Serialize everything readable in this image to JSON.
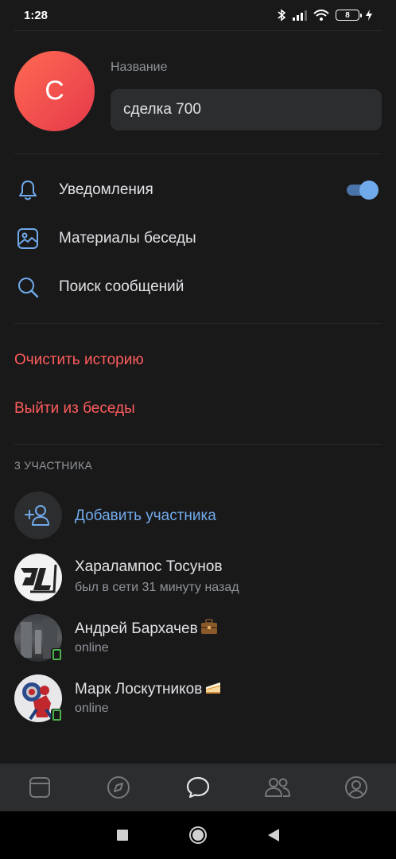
{
  "status_bar": {
    "time": "1:28",
    "battery": "8"
  },
  "header": {
    "avatar_letter": "С",
    "name_label": "Название",
    "name_value": "сделка 700"
  },
  "menu": [
    {
      "label": "Уведомления",
      "icon": "bell-icon",
      "toggle_on": true
    },
    {
      "label": "Материалы беседы",
      "icon": "image-icon"
    },
    {
      "label": "Поиск сообщений",
      "icon": "search-icon"
    }
  ],
  "actions": {
    "clear_history": "Очистить историю",
    "leave_chat": "Выйти из беседы"
  },
  "members": {
    "section_title": "3 УЧАСТНИКА",
    "add_label": "Добавить участника",
    "list": [
      {
        "name": "Харалампос Тосунов",
        "status": "был в сети 31 минуту назад",
        "online": false
      },
      {
        "name": "Андрей Бархачев",
        "status": "online",
        "online": true,
        "emoji": "briefcase-emoji"
      },
      {
        "name": "Марк Лоскутников",
        "status": "online",
        "online": true,
        "emoji": "cake-emoji"
      }
    ]
  },
  "tabs": [
    "newsfeed-tab",
    "discover-tab",
    "messages-tab",
    "friends-tab",
    "profile-tab"
  ],
  "colors": {
    "accent": "#71aaeb",
    "danger": "#ff5c5c",
    "online": "#4bb34b",
    "background": "#19191a",
    "surface": "#2c2d2e"
  }
}
